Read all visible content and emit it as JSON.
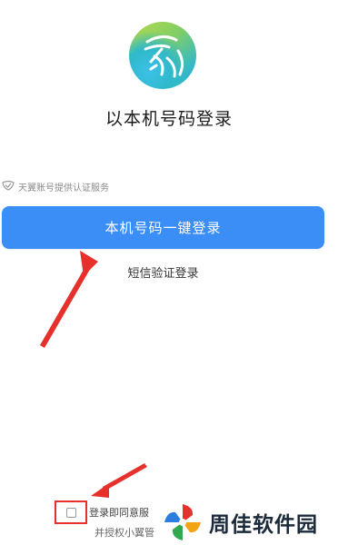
{
  "title": "以本机号码登录",
  "provider_text": "天翼账号提供认证服务",
  "primary_button": "本机号码一键登录",
  "sms_login": "短信验证登录",
  "agreement": {
    "line1": "登录即同意服",
    "line2": "并授权小翼管"
  },
  "watermark": "周佳软件园",
  "colors": {
    "primary": "#3a8ef6",
    "annotation": "#e5302c"
  },
  "icons": {
    "app_logo": "fingerprint-logo-icon",
    "provider": "shield-check-icon",
    "watermark_logo": "pinwheel-logo-icon"
  }
}
